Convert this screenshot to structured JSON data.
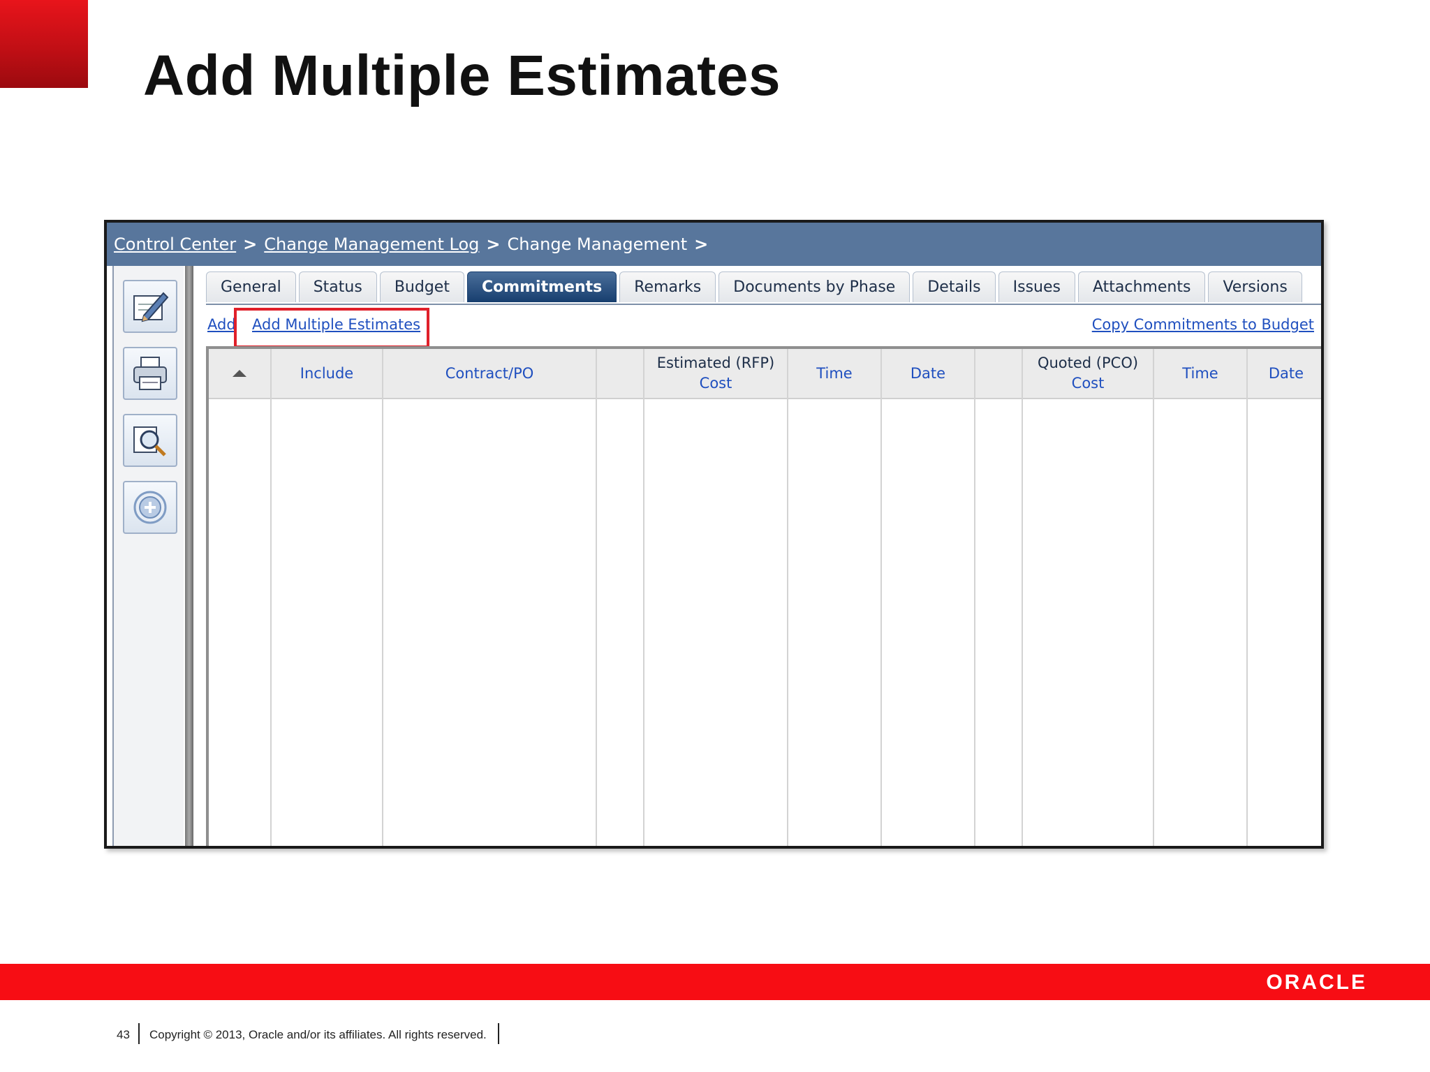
{
  "slide": {
    "title": "Add Multiple Estimates",
    "page_number": "43",
    "copyright": "Copyright © 2013, Oracle and/or its affiliates. All rights reserved.",
    "logo": "ORACLE"
  },
  "breadcrumb": {
    "items": [
      "Control Center",
      "Change Management Log",
      "Change Management"
    ],
    "separator": ">"
  },
  "toolbar": {
    "icons": [
      "edit-icon",
      "print-icon",
      "search-preview-icon",
      "add-circle-icon"
    ]
  },
  "tabs": [
    {
      "label": "General"
    },
    {
      "label": "Status"
    },
    {
      "label": "Budget"
    },
    {
      "label": "Commitments",
      "active": true
    },
    {
      "label": "Remarks"
    },
    {
      "label": "Documents by Phase"
    },
    {
      "label": "Details"
    },
    {
      "label": "Issues"
    },
    {
      "label": "Attachments"
    },
    {
      "label": "Versions"
    }
  ],
  "actions": {
    "add": "Add",
    "add_multiple": "Add Multiple Estimates",
    "copy": "Copy Commitments to Budget"
  },
  "grid": {
    "columns": {
      "sort": "",
      "include": "Include",
      "contract": "Contract/PO",
      "blank1": "",
      "est_top": "Estimated (RFP)",
      "est_cost": "Cost",
      "est_time": "Time",
      "est_date": "Date",
      "blank2": "",
      "quoted_top": "Quoted (PCO)",
      "quoted_cost": "Cost",
      "quoted_time": "Time",
      "quoted_date": "Date"
    },
    "rows": []
  },
  "colors": {
    "accent_red": "#f70d14",
    "breadcrumb_bar": "#58769c",
    "active_tab": "#173e6e",
    "link": "#1f4fbf",
    "highlight": "#e0202a"
  }
}
